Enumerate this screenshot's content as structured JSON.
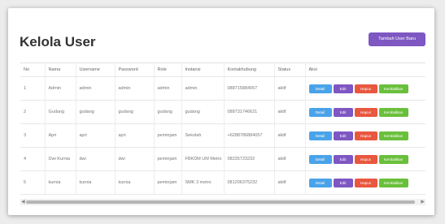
{
  "page": {
    "title": "Kelola User",
    "add_button": "Tambah User Baru"
  },
  "table": {
    "headers": [
      "No",
      "Nama",
      "Username",
      "Password",
      "Role",
      "Instansi",
      "Kontakhubung",
      "Status",
      "Aksi"
    ],
    "rows": [
      [
        "1",
        "Admin",
        "admin",
        "admin",
        "admin",
        "admin",
        "088715884057",
        "aktif"
      ],
      [
        "2",
        "Gudang",
        "gudang",
        "gudang",
        "gudang",
        "gudang",
        "088731746621",
        "aktif"
      ],
      [
        "3",
        "Apri",
        "apri",
        "apri",
        "peminjam",
        "Sekolah",
        "+6288786884057",
        "aktif"
      ],
      [
        "4",
        "Dwi Kurnia",
        "dwi",
        "dwi",
        "peminjam",
        "FBKDM UM Metro",
        "08235723232",
        "aktif"
      ],
      [
        "5",
        "kurnia",
        "kurnia",
        "kurnia",
        "peminjam",
        "SMK 3 metro",
        "081206375232",
        "aktif"
      ]
    ],
    "actions": [
      "Detail",
      "Edit",
      "Hapus",
      "Kembalikan"
    ]
  },
  "colors": {
    "primary": "#7e57c2",
    "detail": "#4aa3e8",
    "hapus": "#e9573f",
    "kembali": "#6abf3c"
  }
}
